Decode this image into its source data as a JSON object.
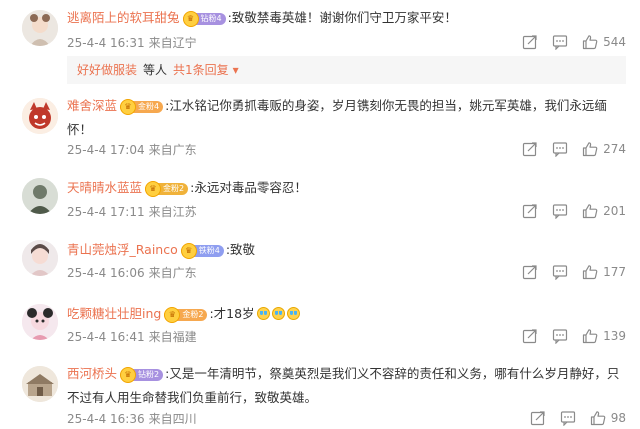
{
  "colors": {
    "username": "#eb7350",
    "meta": "#8a8a8a",
    "text": "#333333",
    "reply_bg": "#f6f6f6"
  },
  "comments": [
    {
      "username": "逃离陌上的软耳甜兔",
      "badge": "钻粉4",
      "text": ":致敬禁毒英雄！谢谢你们守卫万家平安！",
      "date": "25-4-4 16:31",
      "location": "来自辽宁",
      "likes": "544",
      "icons": [
        "share-icon",
        "comment-icon",
        "like-icon"
      ],
      "reply_summary": {
        "user": "好好做服装",
        "middle": "等人",
        "link": "共1条回复",
        "arrow": "▾"
      }
    },
    {
      "username": "难舍深蓝",
      "badge": "金粉4",
      "text": ":江水铭记你勇抓毒贩的身姿，岁月镌刻你无畏的担当，姚元军英雄，我们永远缅怀！",
      "date": "25-4-4 17:04",
      "location": "来自广东",
      "likes": "274"
    },
    {
      "username": "天晴晴水蓝蓝",
      "badge": "金粉2",
      "text": ":永远对毒品零容忍！",
      "date": "25-4-4 17:11",
      "location": "来自江苏",
      "likes": "201"
    },
    {
      "username": "青山莞烛浮_Rainco",
      "badge": "铁粉4",
      "text": ":致敬",
      "date": "25-4-4 16:06",
      "location": "来自广东",
      "likes": "177"
    },
    {
      "username": "吃颗糖壮壮胆ing",
      "badge": "金粉2",
      "text": ":才18岁",
      "emojis": [
        "crying-emoji",
        "crying-emoji",
        "crying-emoji"
      ],
      "date": "25-4-4 16:41",
      "location": "来自福建",
      "likes": "139"
    },
    {
      "username": "西河桥头",
      "badge": "钻粉2",
      "text": ":又是一年清明节，祭奠英烈是我们义不容辞的责任和义务，哪有什么岁月静好，只不过有人用生命替我们负重前行，致敬英雄。",
      "date": "25-4-4 16:36",
      "location": "来自四川",
      "likes": "98"
    }
  ]
}
